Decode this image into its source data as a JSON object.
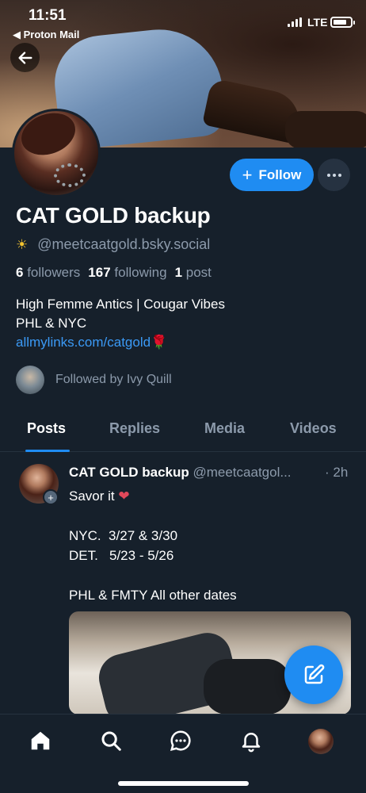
{
  "status_bar": {
    "time": "11:51",
    "back_app": "◀ Proton Mail",
    "network": "LTE"
  },
  "profile": {
    "display_name": "CAT GOLD backup",
    "handle_emoji": "☀",
    "handle": "@meetcaatgold.bsky.social",
    "follow_label": "Follow",
    "followers_count": "6",
    "followers_label": "followers",
    "following_count": "167",
    "following_label": "following",
    "posts_count": "1",
    "posts_label": "post",
    "bio_line1": "High Femme Antics | Cougar Vibes",
    "bio_line2": "PHL & NYC",
    "bio_link": "allmylinks.com/catgold",
    "bio_link_emoji": "🌹",
    "followed_by": "Followed by Ivy Quill"
  },
  "tabs": [
    {
      "label": "Posts",
      "active": true
    },
    {
      "label": "Replies",
      "active": false
    },
    {
      "label": "Media",
      "active": false
    },
    {
      "label": "Videos",
      "active": false
    }
  ],
  "post": {
    "author_name": "CAT GOLD backup",
    "author_handle": "@meetcaatgol...",
    "time": "· 2h",
    "text": "Savor it ",
    "text_emoji": "❤",
    "text_rest": "\n\nNYC.  3/27 & 3/30\nDET.   5/23 - 5/26\n\nPHL & FMTY All other dates"
  },
  "bottom_nav": [
    "home-icon",
    "search-icon",
    "chat-icon",
    "bell-icon",
    "profile-avatar"
  ],
  "colors": {
    "background": "#16202b",
    "accent": "#1f8cf2",
    "muted_text": "#8c9aab",
    "link": "#3b9af6"
  }
}
